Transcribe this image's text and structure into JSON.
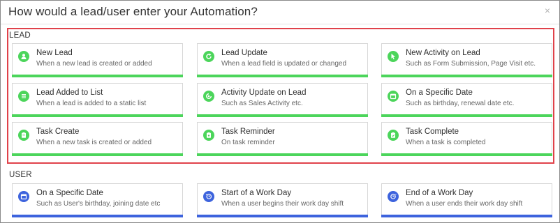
{
  "dialog": {
    "title": "How would a lead/user enter your Automation?",
    "close_glyph": "×"
  },
  "colors": {
    "lead_accent": "#4cd55b",
    "user_accent": "#3d63dd",
    "highlight_border": "#e0424a"
  },
  "lead": {
    "label": "LEAD",
    "cards": [
      {
        "title": "New Lead",
        "desc": "When a new lead is created or added",
        "icon": "user-icon"
      },
      {
        "title": "Lead Update",
        "desc": "When a lead field is updated or changed",
        "icon": "refresh-icon"
      },
      {
        "title": "New Activity on Lead",
        "desc": "Such as Form Submission, Page Visit etc.",
        "icon": "cursor-icon"
      },
      {
        "title": "Lead Added to List",
        "desc": "When a lead is added to a static list",
        "icon": "list-icon"
      },
      {
        "title": "Activity Update on Lead",
        "desc": "Such as Sales Activity etc.",
        "icon": "activity-refresh-icon"
      },
      {
        "title": "On a Specific Date",
        "desc": "Such as birthday, renewal date etc.",
        "icon": "calendar-icon"
      },
      {
        "title": "Task Create",
        "desc": "When a new task is created or added",
        "icon": "task-icon"
      },
      {
        "title": "Task Reminder",
        "desc": "On task reminder",
        "icon": "task-bell-icon"
      },
      {
        "title": "Task Complete",
        "desc": "When a task is completed",
        "icon": "task-check-icon"
      }
    ]
  },
  "user": {
    "label": "USER",
    "cards": [
      {
        "title": "On a Specific Date",
        "desc": "Such as User's birthday, joining date etc",
        "icon": "calendar-icon"
      },
      {
        "title": "Start of a Work Day",
        "desc": "When a user begins their work day shift",
        "icon": "clock-start-icon"
      },
      {
        "title": "End of a Work Day",
        "desc": "When a user ends their work day shift",
        "icon": "clock-end-icon"
      }
    ]
  }
}
